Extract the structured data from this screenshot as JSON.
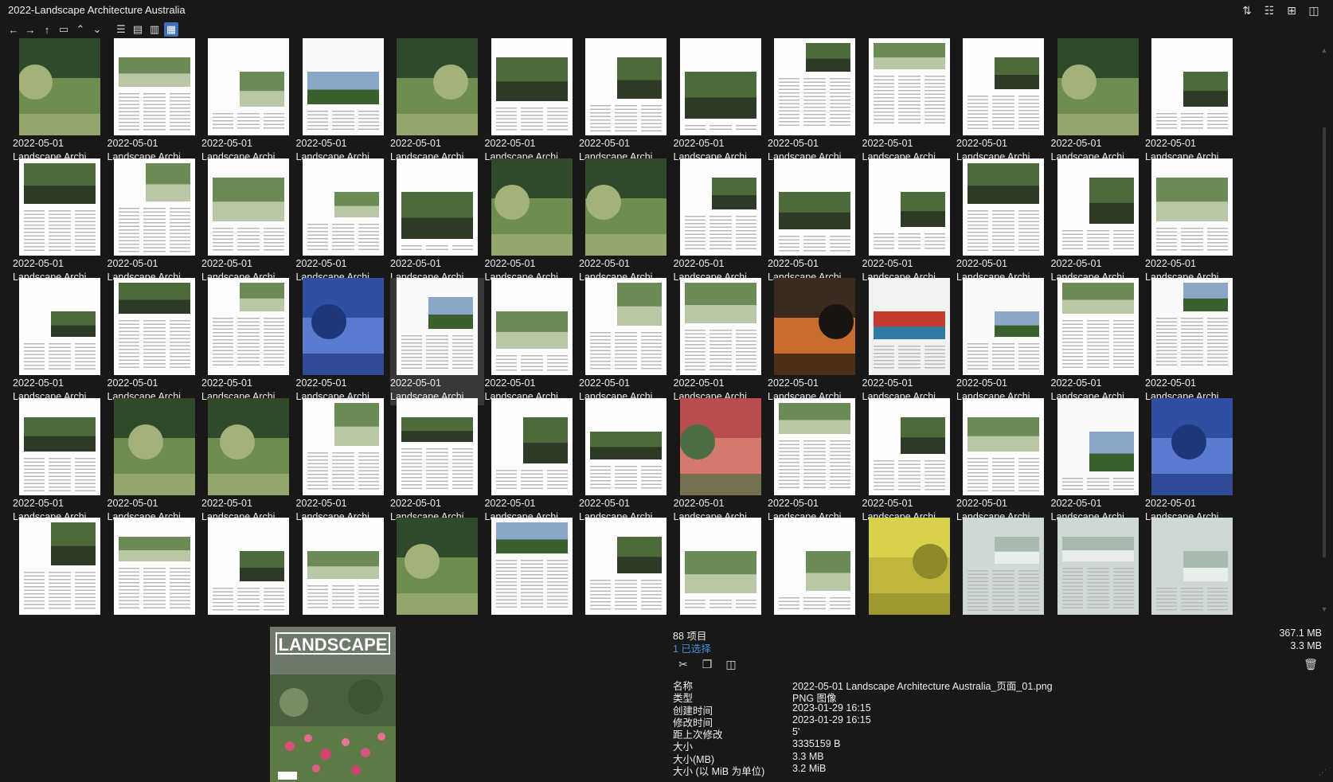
{
  "window": {
    "title": "2022-Landscape Architecture Australia"
  },
  "toolbar": {
    "items": [
      {
        "icon": "back-arrow-icon",
        "glyph": "←"
      },
      {
        "icon": "forward-arrow-icon",
        "glyph": "→"
      },
      {
        "icon": "up-arrow-icon",
        "glyph": "↑"
      },
      {
        "icon": "folder-icon",
        "glyph": "▭"
      },
      {
        "icon": "chevron-up-icon",
        "glyph": "⌃"
      },
      {
        "icon": "chevron-down-icon",
        "glyph": "⌄"
      },
      {
        "icon": "list-view-icon",
        "glyph": "☰"
      },
      {
        "icon": "details-view-icon",
        "glyph": "▤"
      },
      {
        "icon": "compact-view-icon",
        "glyph": "▥"
      },
      {
        "icon": "thumbnail-view-icon",
        "glyph": "▦",
        "active": true
      }
    ],
    "right_items": [
      {
        "icon": "sort-icon",
        "glyph": "⇅"
      },
      {
        "icon": "tree-view-icon",
        "glyph": "☷"
      },
      {
        "icon": "new-pane-icon",
        "glyph": "⊞"
      },
      {
        "icon": "dual-pane-icon",
        "glyph": "◫"
      }
    ]
  },
  "thumb_palettes": [
    [
      "#fefefe",
      "#4d6a3a",
      "#2c3a26"
    ],
    [
      "#fdfdfd",
      "#6b8a55",
      "#b8c7a6"
    ],
    [
      "#2f4a2a",
      "#6f8d4f",
      "#a3b17a"
    ],
    [
      "#fafafa",
      "#8aa6c8",
      "#3c5f2e"
    ],
    [
      "#b94c4f",
      "#d47a6c",
      "#4c6c45"
    ],
    [
      "#d8d24a",
      "#bfb73d",
      "#8e8a2a"
    ],
    [
      "#cfd9d3",
      "#a9bab1",
      "#e8efea"
    ],
    [
      "#2f4fa3",
      "#5a7bd0",
      "#1e367c"
    ],
    [
      "#f2f2f2",
      "#c33d2e",
      "#2e7aa0"
    ],
    [
      "#3b2a20",
      "#c66d2f",
      "#1a1410"
    ]
  ],
  "grid": {
    "items": [
      {
        "date": "2022-05-01",
        "name": "Landscape Archi...",
        "p": 2
      },
      {
        "date": "2022-05-01",
        "name": "Landscape Archi...",
        "p": 1
      },
      {
        "date": "2022-05-01",
        "name": "Landscape Archi...",
        "p": 1
      },
      {
        "date": "2022-05-01",
        "name": "Landscape Archi...",
        "p": 3
      },
      {
        "date": "2022-05-01",
        "name": "Landscape Archi...",
        "p": 2
      },
      {
        "date": "2022-05-01",
        "name": "Landscape Archi...",
        "p": 0
      },
      {
        "date": "2022-05-01",
        "name": "Landscape Archi...",
        "p": 0
      },
      {
        "date": "2022-05-01",
        "name": "Landscape Archi...",
        "p": 0
      },
      {
        "date": "2022-05-01",
        "name": "Landscape Archi...",
        "p": 0
      },
      {
        "date": "2022-05-01",
        "name": "Landscape Archi...",
        "p": 1
      },
      {
        "date": "2022-05-01",
        "name": "Landscape Archi...",
        "p": 0
      },
      {
        "date": "2022-05-01",
        "name": "Landscape Archi...",
        "p": 2
      },
      {
        "date": "2022-05-01",
        "name": "Landscape Archi...",
        "p": 0
      },
      {
        "date": "2022-05-01",
        "name": "Landscape Archi...",
        "p": 0
      },
      {
        "date": "2022-05-01",
        "name": "Landscape Archi...",
        "p": 1
      },
      {
        "date": "2022-05-01",
        "name": "Landscape Archi...",
        "p": 1
      },
      {
        "date": "2022-05-01",
        "name": "Landscape Archi...",
        "p": 1
      },
      {
        "date": "2022-05-01",
        "name": "Landscape Archi...",
        "p": 0
      },
      {
        "date": "2022-05-01",
        "name": "Landscape Archi...",
        "p": 2
      },
      {
        "date": "2022-05-01",
        "name": "Landscape Archi...",
        "p": 2
      },
      {
        "date": "2022-05-01",
        "name": "Landscape Archi...",
        "p": 0
      },
      {
        "date": "2022-05-01",
        "name": "Landscape Archi...",
        "p": 0
      },
      {
        "date": "2022-05-01",
        "name": "Landscape Archi...",
        "p": 0
      },
      {
        "date": "2022-05-01",
        "name": "Landscape Archi...",
        "p": 0
      },
      {
        "date": "2022-05-01",
        "name": "Landscape Archi...",
        "p": 0
      },
      {
        "date": "2022-05-01",
        "name": "Landscape Archi...",
        "p": 1
      },
      {
        "date": "2022-05-01",
        "name": "Landscape Archi...",
        "p": 0
      },
      {
        "date": "2022-05-01",
        "name": "Landscape Archi...",
        "p": 0
      },
      {
        "date": "2022-05-01",
        "name": "Landscape Archi...",
        "p": 1
      },
      {
        "date": "2022-05-01",
        "name": "Landscape Archi...",
        "p": 7
      },
      {
        "date": "2022-05-01",
        "name": "Landscape Archi...",
        "p": 3,
        "selected": true
      },
      {
        "date": "2022-05-01",
        "name": "Landscape Archi...",
        "p": 1
      },
      {
        "date": "2022-05-01",
        "name": "Landscape Archi...",
        "p": 1
      },
      {
        "date": "2022-05-01",
        "name": "Landscape Archi...",
        "p": 1
      },
      {
        "date": "2022-05-01",
        "name": "Landscape Archi...",
        "p": 9
      },
      {
        "date": "2022-05-01",
        "name": "Landscape Archi...",
        "p": 8
      },
      {
        "date": "2022-05-01",
        "name": "Landscape Archi...",
        "p": 3
      },
      {
        "date": "2022-05-01",
        "name": "Landscape Archi...",
        "p": 1
      },
      {
        "date": "2022-05-01",
        "name": "Landscape Archi...",
        "p": 3
      },
      {
        "date": "2022-05-01",
        "name": "Landscape Archi...",
        "p": 0
      },
      {
        "date": "2022-05-01",
        "name": "Landscape Archi...",
        "p": 2
      },
      {
        "date": "2022-05-01",
        "name": "Landscape Archi...",
        "p": 2
      },
      {
        "date": "2022-05-01",
        "name": "Landscape Archi...",
        "p": 1
      },
      {
        "date": "2022-05-01",
        "name": "Landscape Archi...",
        "p": 0
      },
      {
        "date": "2022-05-01",
        "name": "Landscape Archi...",
        "p": 0
      },
      {
        "date": "2022-05-01",
        "name": "Landscape Archi...",
        "p": 0
      },
      {
        "date": "2022-05-01",
        "name": "Landscape Archi...",
        "p": 4
      },
      {
        "date": "2022-05-01",
        "name": "Landscape Archi...",
        "p": 1
      },
      {
        "date": "2022-05-01",
        "name": "Landscape Archi...",
        "p": 0
      },
      {
        "date": "2022-05-01",
        "name": "Landscape Archi...",
        "p": 1
      },
      {
        "date": "2022-05-01",
        "name": "Landscape Archi...",
        "p": 3
      },
      {
        "date": "2022-05-01",
        "name": "Landscape Archi...",
        "p": 7
      },
      {
        "date": "",
        "name": "",
        "p": 0
      },
      {
        "date": "",
        "name": "",
        "p": 1
      },
      {
        "date": "",
        "name": "",
        "p": 0
      },
      {
        "date": "",
        "name": "",
        "p": 1
      },
      {
        "date": "",
        "name": "",
        "p": 2
      },
      {
        "date": "",
        "name": "",
        "p": 3
      },
      {
        "date": "",
        "name": "",
        "p": 0
      },
      {
        "date": "",
        "name": "",
        "p": 1
      },
      {
        "date": "",
        "name": "",
        "p": 1
      },
      {
        "date": "",
        "name": "",
        "p": 5
      },
      {
        "date": "",
        "name": "",
        "p": 6
      },
      {
        "date": "",
        "name": "",
        "p": 6
      },
      {
        "date": "",
        "name": "",
        "p": 6
      }
    ]
  },
  "status": {
    "count": "88 项目",
    "selected": "1 已选择",
    "total_size": "367.1 MB",
    "selected_size": "3.3 MB"
  },
  "preview": {
    "cover_title": "LANDSCAPE"
  },
  "actions": [
    {
      "icon": "cut-icon",
      "glyph": "✂"
    },
    {
      "icon": "copy-icon",
      "glyph": "❐"
    },
    {
      "icon": "compare-icon",
      "glyph": "◫"
    }
  ],
  "properties": [
    {
      "k": "名称",
      "v": "2022-05-01 Landscape Architecture Australia_页面_01.png"
    },
    {
      "k": "类型",
      "v": "PNG 图像"
    },
    {
      "k": "创建时间",
      "v": "2023-01-29  16:15"
    },
    {
      "k": "修改时间",
      "v": "2023-01-29  16:15"
    },
    {
      "k": "距上次修改",
      "v": "5'"
    },
    {
      "k": "大小",
      "v": "3335159 B"
    },
    {
      "k": "大小(MB)",
      "v": "3.3 MB"
    },
    {
      "k": "大小 (以 MiB 为单位)",
      "v": "3.2 MiB"
    }
  ]
}
